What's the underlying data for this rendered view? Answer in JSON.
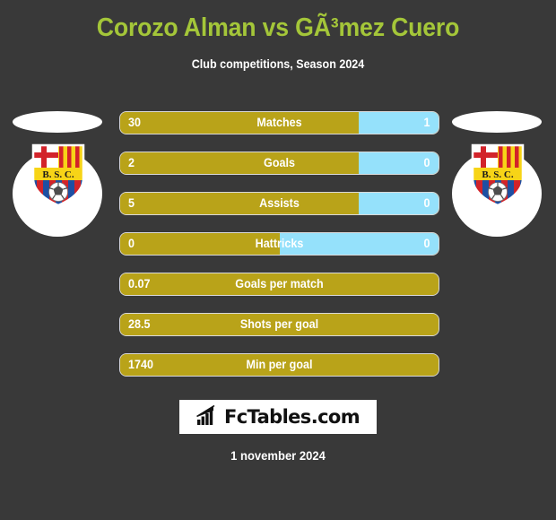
{
  "header": {
    "title": "Corozo Alman vs GÃ³mez Cuero",
    "subtitle": "Club competitions, Season 2024",
    "title_color": "#a4c639"
  },
  "colors": {
    "background": "#393939",
    "left_bar": "#b9a319",
    "right_bar": "#95e1fb",
    "text": "#ffffff"
  },
  "teams": {
    "left": {
      "crest_name": "barcelona-sc-crest",
      "crest_initials": "B. S. C."
    },
    "right": {
      "crest_name": "barcelona-sc-crest",
      "crest_initials": "B. S. C."
    }
  },
  "stats": [
    {
      "label": "Matches",
      "left": "30",
      "right": "1",
      "left_pct": 75,
      "split": true
    },
    {
      "label": "Goals",
      "left": "2",
      "right": "0",
      "left_pct": 75,
      "split": true
    },
    {
      "label": "Assists",
      "left": "5",
      "right": "0",
      "left_pct": 75,
      "split": true
    },
    {
      "label": "Hattricks",
      "left": "0",
      "right": "0",
      "left_pct": 50,
      "split": true
    },
    {
      "label": "Goals per match",
      "left": "0.07",
      "right": "",
      "left_pct": 100,
      "split": false
    },
    {
      "label": "Shots per goal",
      "left": "28.5",
      "right": "",
      "left_pct": 100,
      "split": false
    },
    {
      "label": "Min per goal",
      "left": "1740",
      "right": "",
      "left_pct": 100,
      "split": false
    }
  ],
  "footer": {
    "brand": "FcTables.com",
    "brand_icon": "bar-chart-icon",
    "date": "1 november 2024"
  }
}
